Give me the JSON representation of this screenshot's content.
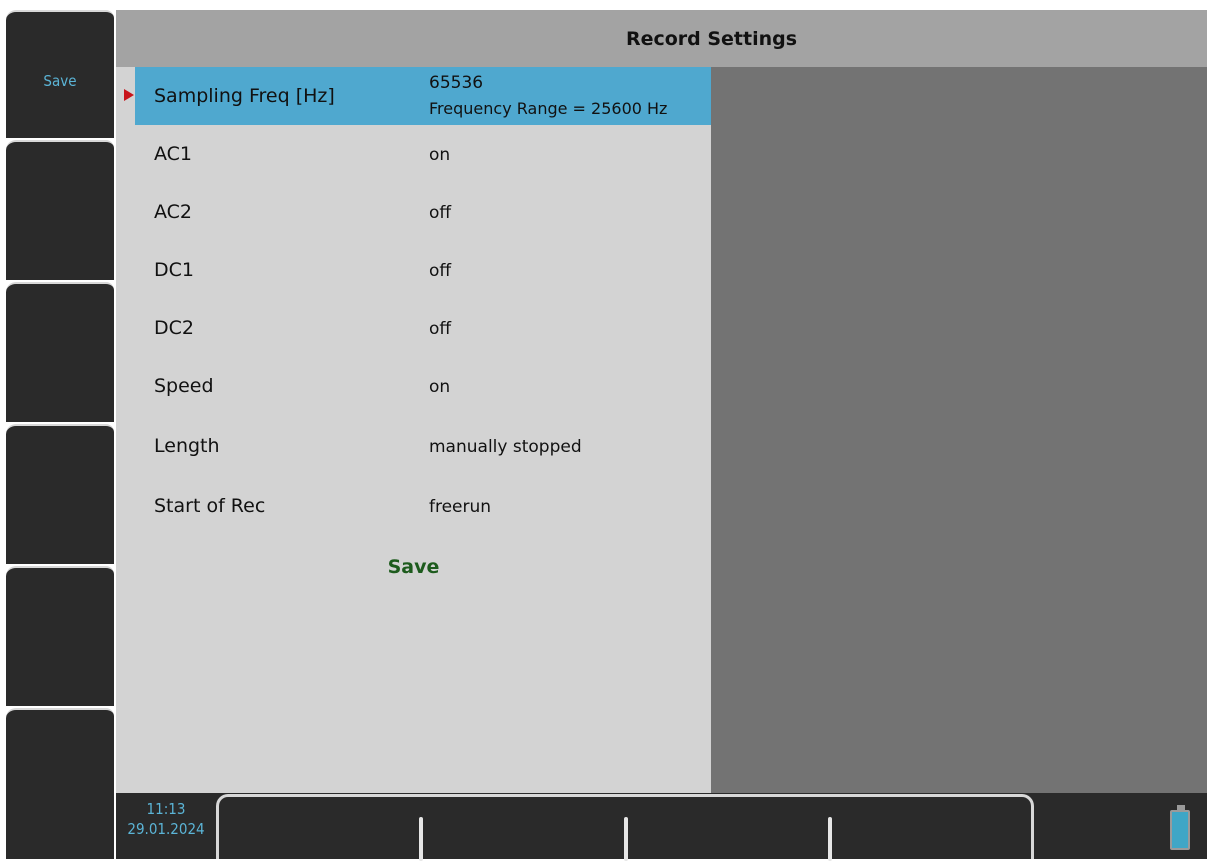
{
  "header": {
    "title": "Record Settings"
  },
  "softkeys": [
    {
      "label": "Save"
    },
    {
      "label": ""
    },
    {
      "label": ""
    },
    {
      "label": ""
    },
    {
      "label": ""
    },
    {
      "label": ""
    }
  ],
  "settings": {
    "sampling": {
      "label": "Sampling Freq [Hz]",
      "value": "65536",
      "subvalue": "Frequency Range = 25600 Hz"
    },
    "rows": [
      {
        "label": "AC1",
        "value": "on"
      },
      {
        "label": "AC2",
        "value": "off"
      },
      {
        "label": "DC1",
        "value": "off"
      },
      {
        "label": "DC2",
        "value": "off"
      },
      {
        "label": "Speed",
        "value": "on"
      },
      {
        "label": "Length",
        "value": "manually stopped"
      },
      {
        "label": "Start of Rec",
        "value": "freerun"
      }
    ],
    "save_label": "Save"
  },
  "status": {
    "time": "11:13",
    "date": "29.01.2024"
  },
  "colors": {
    "accent": "#4fa8cf",
    "save_text": "#1d5b1d",
    "pointer": "#c8141a",
    "label_blue": "#5bb4d6"
  }
}
